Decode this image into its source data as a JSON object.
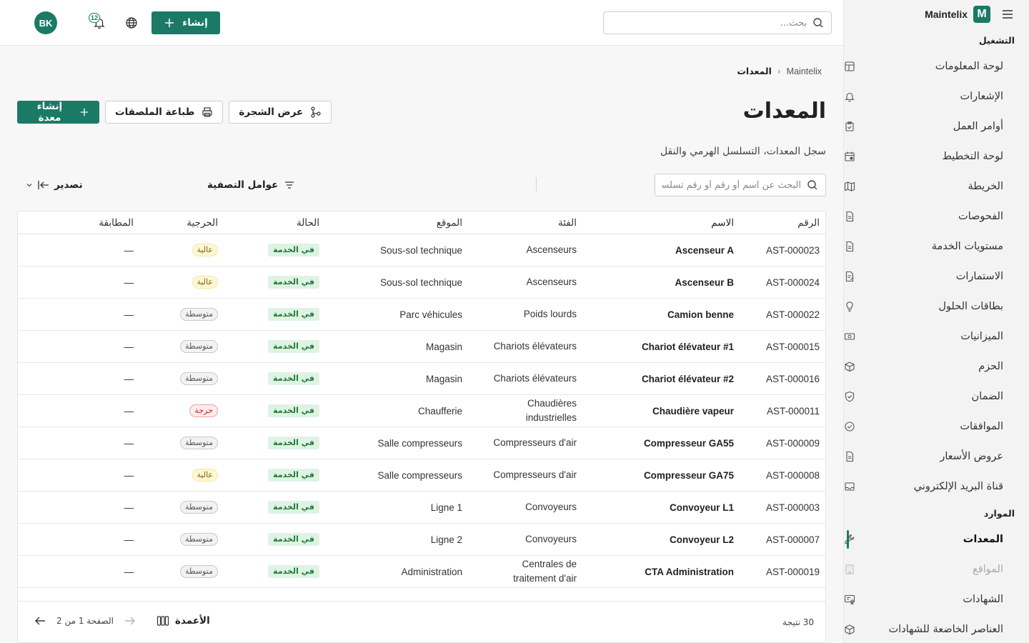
{
  "app": {
    "name": "Maintelix",
    "logo_letter": "M",
    "accent": "#1a7a66"
  },
  "topbar": {
    "search_placeholder": "بحث...",
    "create_label": "إنشاء",
    "notifications_count": "12",
    "user_initials": "BK"
  },
  "sidebar": {
    "section_operations": "التشغيل",
    "operations": [
      {
        "label": "لوحة المعلومات",
        "icon": "dashboard-icon"
      },
      {
        "label": "الإشعارات",
        "icon": "bell-icon"
      },
      {
        "label": "أوامر العمل",
        "icon": "clipboard-icon"
      },
      {
        "label": "لوحة التخطيط",
        "icon": "calendar-icon"
      },
      {
        "label": "الخريطة",
        "icon": "map-icon"
      },
      {
        "label": "الفحوصات",
        "icon": "document-icon"
      },
      {
        "label": "مستويات الخدمة",
        "icon": "document-icon"
      },
      {
        "label": "الاستمارات",
        "icon": "form-icon"
      },
      {
        "label": "بطاقات الحلول",
        "icon": "lightbulb-icon"
      },
      {
        "label": "الميزانيات",
        "icon": "money-icon"
      },
      {
        "label": "الحزم",
        "icon": "package-icon"
      },
      {
        "label": "الضمان",
        "icon": "shield-icon"
      },
      {
        "label": "الموافقات",
        "icon": "check-circle-icon"
      },
      {
        "label": "عروض الأسعار",
        "icon": "document-icon"
      },
      {
        "label": "قناة البريد الإلكتروني",
        "icon": "mail-icon"
      }
    ],
    "section_resources": "الموارد",
    "resources": [
      {
        "label": "المعدات",
        "icon": "wrench-icon",
        "state": "active"
      },
      {
        "label": "المواقع",
        "icon": "building-icon",
        "state": "dim"
      },
      {
        "label": "الشهادات",
        "icon": "certificate-icon",
        "state": ""
      },
      {
        "label": "العناصر الخاضعة للشهادات",
        "icon": "package-icon",
        "state": ""
      }
    ]
  },
  "breadcrumb": {
    "root": "Maintelix",
    "current": "المعدات"
  },
  "page": {
    "title": "المعدات",
    "subtitle": "سجل المعدات، التسلسل الهرمي والنقل"
  },
  "actions": {
    "tree_view": "عرض الشجرة",
    "print_labels": "طباعة الملصقات",
    "create_equipment": "إنشاء معدة"
  },
  "toolbar": {
    "search_placeholder": "البحث عن اسم أو رقم أو رقم تسلسلي",
    "filters_label": "عوامل التصفية",
    "export_label": "تصدير"
  },
  "table": {
    "headers": {
      "id": "الرقم",
      "name": "الاسم",
      "category": "الفئة",
      "location": "الموقع",
      "status": "الحالة",
      "criticality": "الحرجية",
      "match": "المطابقة"
    },
    "rows": [
      {
        "id": "AST-000023",
        "name": "Ascenseur A",
        "category": "Ascenseurs",
        "location": "Sous-sol technique",
        "status": "في الخدمة",
        "criticality": "عالية",
        "crit_level": "high",
        "match": "—"
      },
      {
        "id": "AST-000024",
        "name": "Ascenseur B",
        "category": "Ascenseurs",
        "location": "Sous-sol technique",
        "status": "في الخدمة",
        "criticality": "عالية",
        "crit_level": "high",
        "match": "—"
      },
      {
        "id": "AST-000022",
        "name": "Camion benne",
        "category": "Poids lourds",
        "location": "Parc véhicules",
        "status": "في الخدمة",
        "criticality": "متوسطة",
        "crit_level": "medium",
        "match": "—"
      },
      {
        "id": "AST-000015",
        "name": "Chariot élévateur #1",
        "category": "Chariots élévateurs",
        "location": "Magasin",
        "status": "في الخدمة",
        "criticality": "متوسطة",
        "crit_level": "medium",
        "match": "—"
      },
      {
        "id": "AST-000016",
        "name": "Chariot élévateur #2",
        "category": "Chariots élévateurs",
        "location": "Magasin",
        "status": "في الخدمة",
        "criticality": "متوسطة",
        "crit_level": "medium",
        "match": "—"
      },
      {
        "id": "AST-000011",
        "name": "Chaudière vapeur",
        "category": "Chaudières industrielles",
        "location": "Chaufferie",
        "status": "في الخدمة",
        "criticality": "حرجة",
        "crit_level": "critical",
        "match": "—"
      },
      {
        "id": "AST-000009",
        "name": "Compresseur GA55",
        "category": "Compresseurs d'air",
        "location": "Salle compresseurs",
        "status": "في الخدمة",
        "criticality": "متوسطة",
        "crit_level": "medium",
        "match": "—"
      },
      {
        "id": "AST-000008",
        "name": "Compresseur GA75",
        "category": "Compresseurs d'air",
        "location": "Salle compresseurs",
        "status": "في الخدمة",
        "criticality": "عالية",
        "crit_level": "high",
        "match": "—"
      },
      {
        "id": "AST-000003",
        "name": "Convoyeur L1",
        "category": "Convoyeurs",
        "location": "Ligne 1",
        "status": "في الخدمة",
        "criticality": "متوسطة",
        "crit_level": "medium",
        "match": "—"
      },
      {
        "id": "AST-000007",
        "name": "Convoyeur L2",
        "category": "Convoyeurs",
        "location": "Ligne 2",
        "status": "في الخدمة",
        "criticality": "متوسطة",
        "crit_level": "medium",
        "match": "—"
      },
      {
        "id": "AST-000019",
        "name": "CTA Administration",
        "category": "Centrales de traitement d'air",
        "location": "Administration",
        "status": "في الخدمة",
        "criticality": "متوسطة",
        "crit_level": "medium",
        "match": "—"
      },
      {
        "id": "",
        "name": "",
        "category": "Centrales de",
        "location": "",
        "status": "",
        "criticality": "",
        "crit_level": "",
        "match": ""
      }
    ],
    "footer": {
      "results": "30 نتيجة",
      "columns_label": "الأعمدة",
      "page_info": "الصفحة 1 من 2"
    }
  }
}
